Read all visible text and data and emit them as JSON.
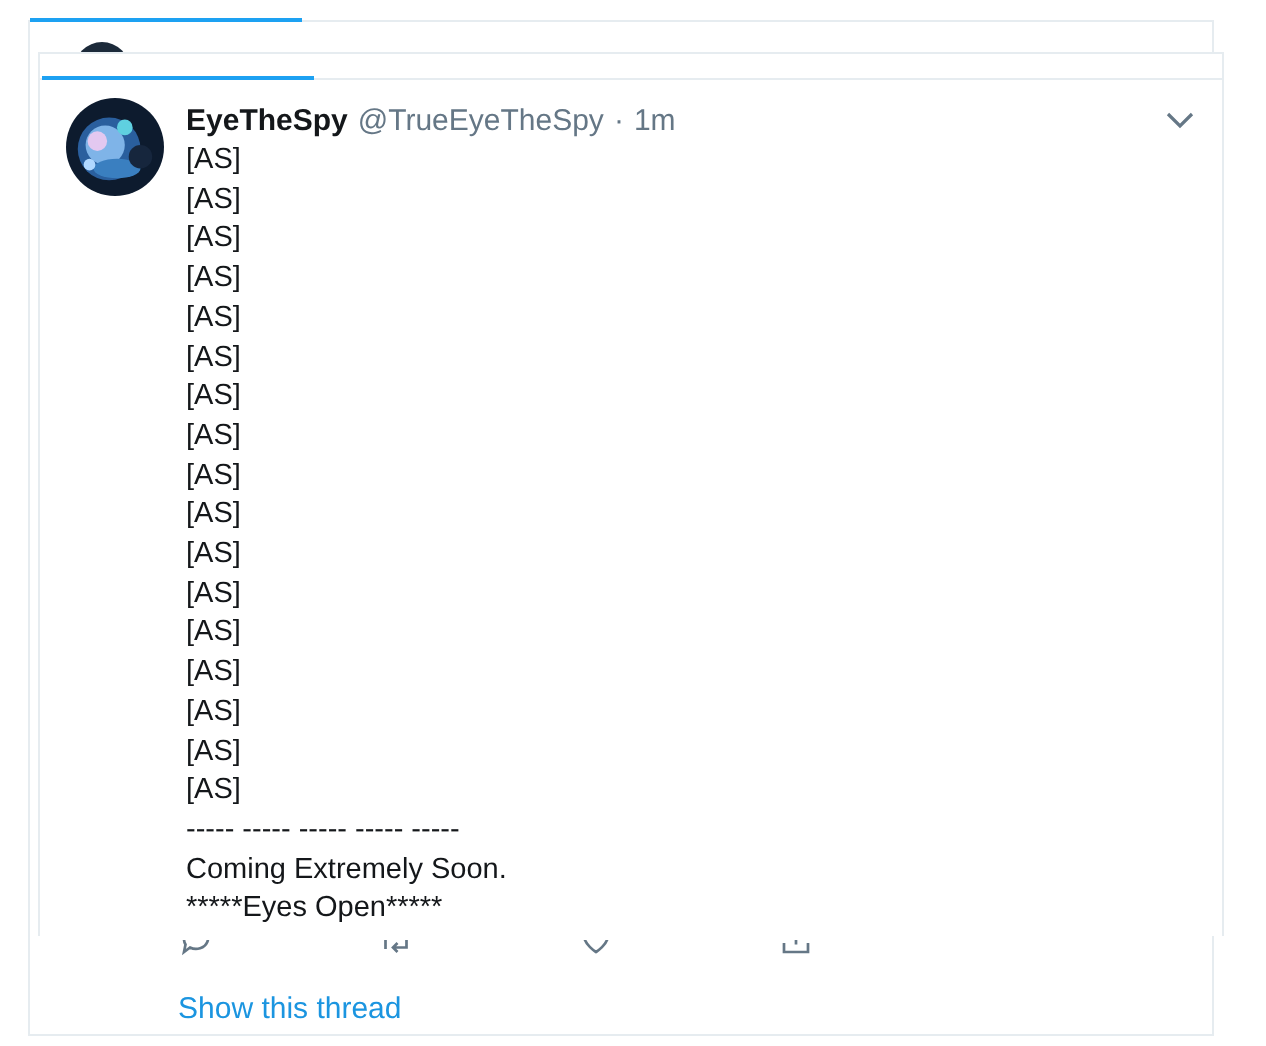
{
  "tweet": {
    "name": "EyeTheSpy",
    "handle": "@TrueEyeTheSpy",
    "separator": "·",
    "time": "1m",
    "lines": [
      "[AS]",
      "[AS]",
      "[AS]",
      "[AS]",
      "[AS]",
      "[AS]",
      "[AS]",
      "[AS]",
      "[AS]",
      "[AS]",
      "[AS]",
      "[AS]",
      "[AS]",
      "[AS]",
      "[AS]",
      "[AS]",
      "[AS]",
      "----- ----- ----- ----- -----",
      "Coming Extremely Soon.",
      "*****Eyes Open*****"
    ]
  },
  "actions": [
    {
      "kind": "reply"
    },
    {
      "kind": "retweet"
    },
    {
      "kind": "like"
    },
    {
      "kind": "share"
    }
  ],
  "show_thread": "Show this thread"
}
